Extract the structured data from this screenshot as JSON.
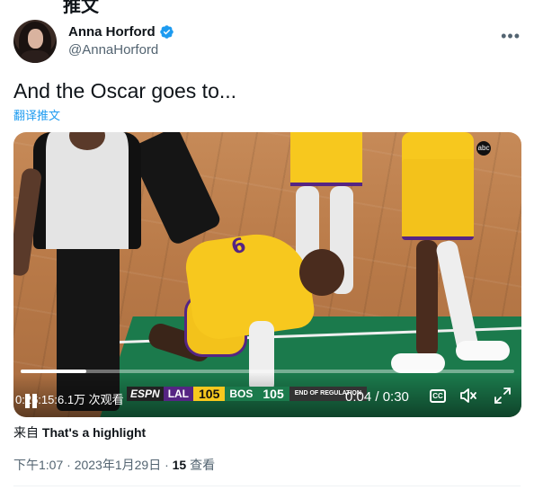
{
  "header": {
    "cut_title": "推文"
  },
  "author": {
    "display_name": "Anna Horford",
    "handle": "@AnnaHorford",
    "verified": true,
    "more_icon": "more-horizontal-icon"
  },
  "tweet": {
    "text": "And the Oscar goes to...",
    "translate_label": "翻译推文"
  },
  "video": {
    "views_overlay": "0:26:15:6.1万 次观看",
    "time": "0:04 / 0:30",
    "progress": 0.133,
    "scoreboard": {
      "network": "ESPN",
      "team1": "LAL",
      "score1": "105",
      "team2": "BOS",
      "score2": "105",
      "period": "END OF REGULATION"
    },
    "jersey_number": "6",
    "network_badge": "abc",
    "cc_label": "CC",
    "icons": [
      "play-pause-icon",
      "cc-icon",
      "mute-icon",
      "fullscreen-icon"
    ]
  },
  "source": {
    "prefix": "来自",
    "name": "That's a highlight"
  },
  "meta": {
    "time": "下午1:07 · 2023年1月29日 · ",
    "views_count": "15",
    "views_label": " 查看"
  },
  "colors": {
    "accent": "#1d9bf0",
    "text": "#0f1419",
    "muted": "#536471",
    "lakers_purple": "#552583",
    "lakers_gold": "#f7c81e"
  }
}
